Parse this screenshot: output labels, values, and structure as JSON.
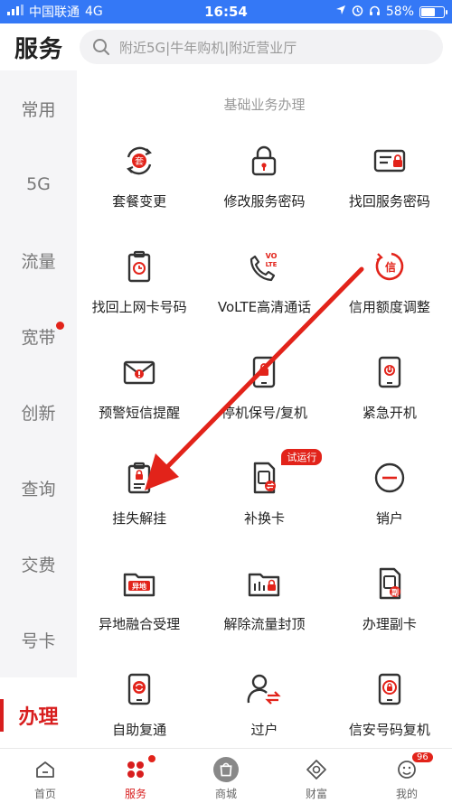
{
  "status_bar": {
    "carrier": "中国联通",
    "network": "4G",
    "time": "16:54",
    "battery": "58%"
  },
  "header": {
    "title": "服务",
    "search_placeholder": "附近5G|牛年购机|附近营业厅"
  },
  "sidebar": {
    "items": [
      {
        "label": "常用",
        "dot": false
      },
      {
        "label": "5G",
        "dot": false
      },
      {
        "label": "流量",
        "dot": false
      },
      {
        "label": "宽带",
        "dot": true
      },
      {
        "label": "创新",
        "dot": false
      },
      {
        "label": "查询",
        "dot": false
      },
      {
        "label": "交费",
        "dot": false
      },
      {
        "label": "号卡",
        "dot": false
      },
      {
        "label": "办理",
        "dot": false,
        "active": true
      }
    ]
  },
  "main": {
    "section_title": "基础业务办理",
    "items": [
      {
        "label": "套餐变更",
        "icon": "package-change-icon"
      },
      {
        "label": "修改服务密码",
        "icon": "lock-icon"
      },
      {
        "label": "找回服务密码",
        "icon": "card-lock-icon"
      },
      {
        "label": "找回上网卡号码",
        "icon": "clipboard-clock-icon"
      },
      {
        "label": "VoLTE高清通话",
        "icon": "volte-phone-icon",
        "icon_text": "VO LTE"
      },
      {
        "label": "信用额度调整",
        "icon": "credit-adjust-icon",
        "icon_text": "信"
      },
      {
        "label": "预警短信提醒",
        "icon": "envelope-alert-icon"
      },
      {
        "label": "停机保号/复机",
        "icon": "phone-lock-icon"
      },
      {
        "label": "紧急开机",
        "icon": "phone-power-icon"
      },
      {
        "label": "挂失解挂",
        "icon": "clipboard-lock-icon"
      },
      {
        "label": "补换卡",
        "icon": "sim-swap-icon",
        "tag": "试运行"
      },
      {
        "label": "销户",
        "icon": "minus-circle-icon"
      },
      {
        "label": "异地融合受理",
        "icon": "folder-remote-icon",
        "icon_text": "异地"
      },
      {
        "label": "解除流量封顶",
        "icon": "folder-lock-icon"
      },
      {
        "label": "办理副卡",
        "icon": "sim-sub-icon",
        "icon_text": "副"
      },
      {
        "label": "自助复通",
        "icon": "phone-refresh-icon"
      },
      {
        "label": "过户",
        "icon": "user-transfer-icon"
      },
      {
        "label": "信安号码复机",
        "icon": "phone-secure-icon"
      }
    ]
  },
  "tabbar": {
    "items": [
      {
        "label": "首页",
        "icon": "home-icon"
      },
      {
        "label": "服务",
        "icon": "service-icon",
        "active": true,
        "dot": true
      },
      {
        "label": "商城",
        "icon": "shop-icon"
      },
      {
        "label": "财富",
        "icon": "wealth-icon"
      },
      {
        "label": "我的",
        "icon": "profile-icon",
        "badge": "96"
      }
    ]
  },
  "colors": {
    "accent": "#d81e1e",
    "status_bar": "#3478f6",
    "annotation_arrow": "#e2231a"
  }
}
